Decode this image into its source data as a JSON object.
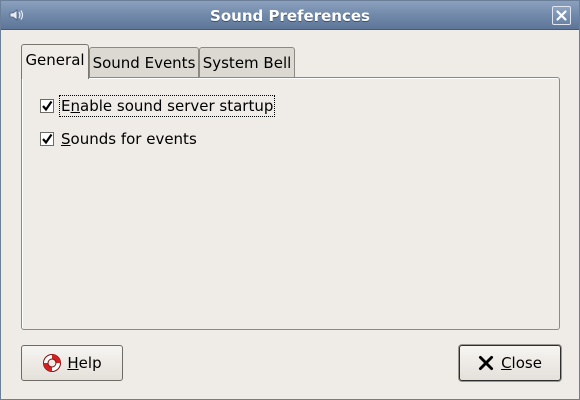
{
  "window": {
    "title": "Sound Preferences",
    "app_icon": "speaker-icon",
    "close_icon": "close-icon"
  },
  "tabs": [
    {
      "label": "General",
      "active": true
    },
    {
      "label": "Sound Events",
      "active": false
    },
    {
      "label": "System Bell",
      "active": false
    }
  ],
  "general": {
    "options": [
      {
        "prefix": "E",
        "mnemonic": "n",
        "rest": "able sound server startup",
        "checked": true
      },
      {
        "prefix": "",
        "mnemonic": "S",
        "rest": "ounds for events",
        "checked": true
      }
    ]
  },
  "buttons": {
    "help": {
      "mnemonic": "H",
      "rest": "elp",
      "icon": "lifebuoy-icon"
    },
    "close": {
      "mnemonic": "C",
      "rest": "lose",
      "icon": "x-icon"
    }
  },
  "colors": {
    "titlebar": "#6f87a8",
    "background": "#efebe7"
  }
}
